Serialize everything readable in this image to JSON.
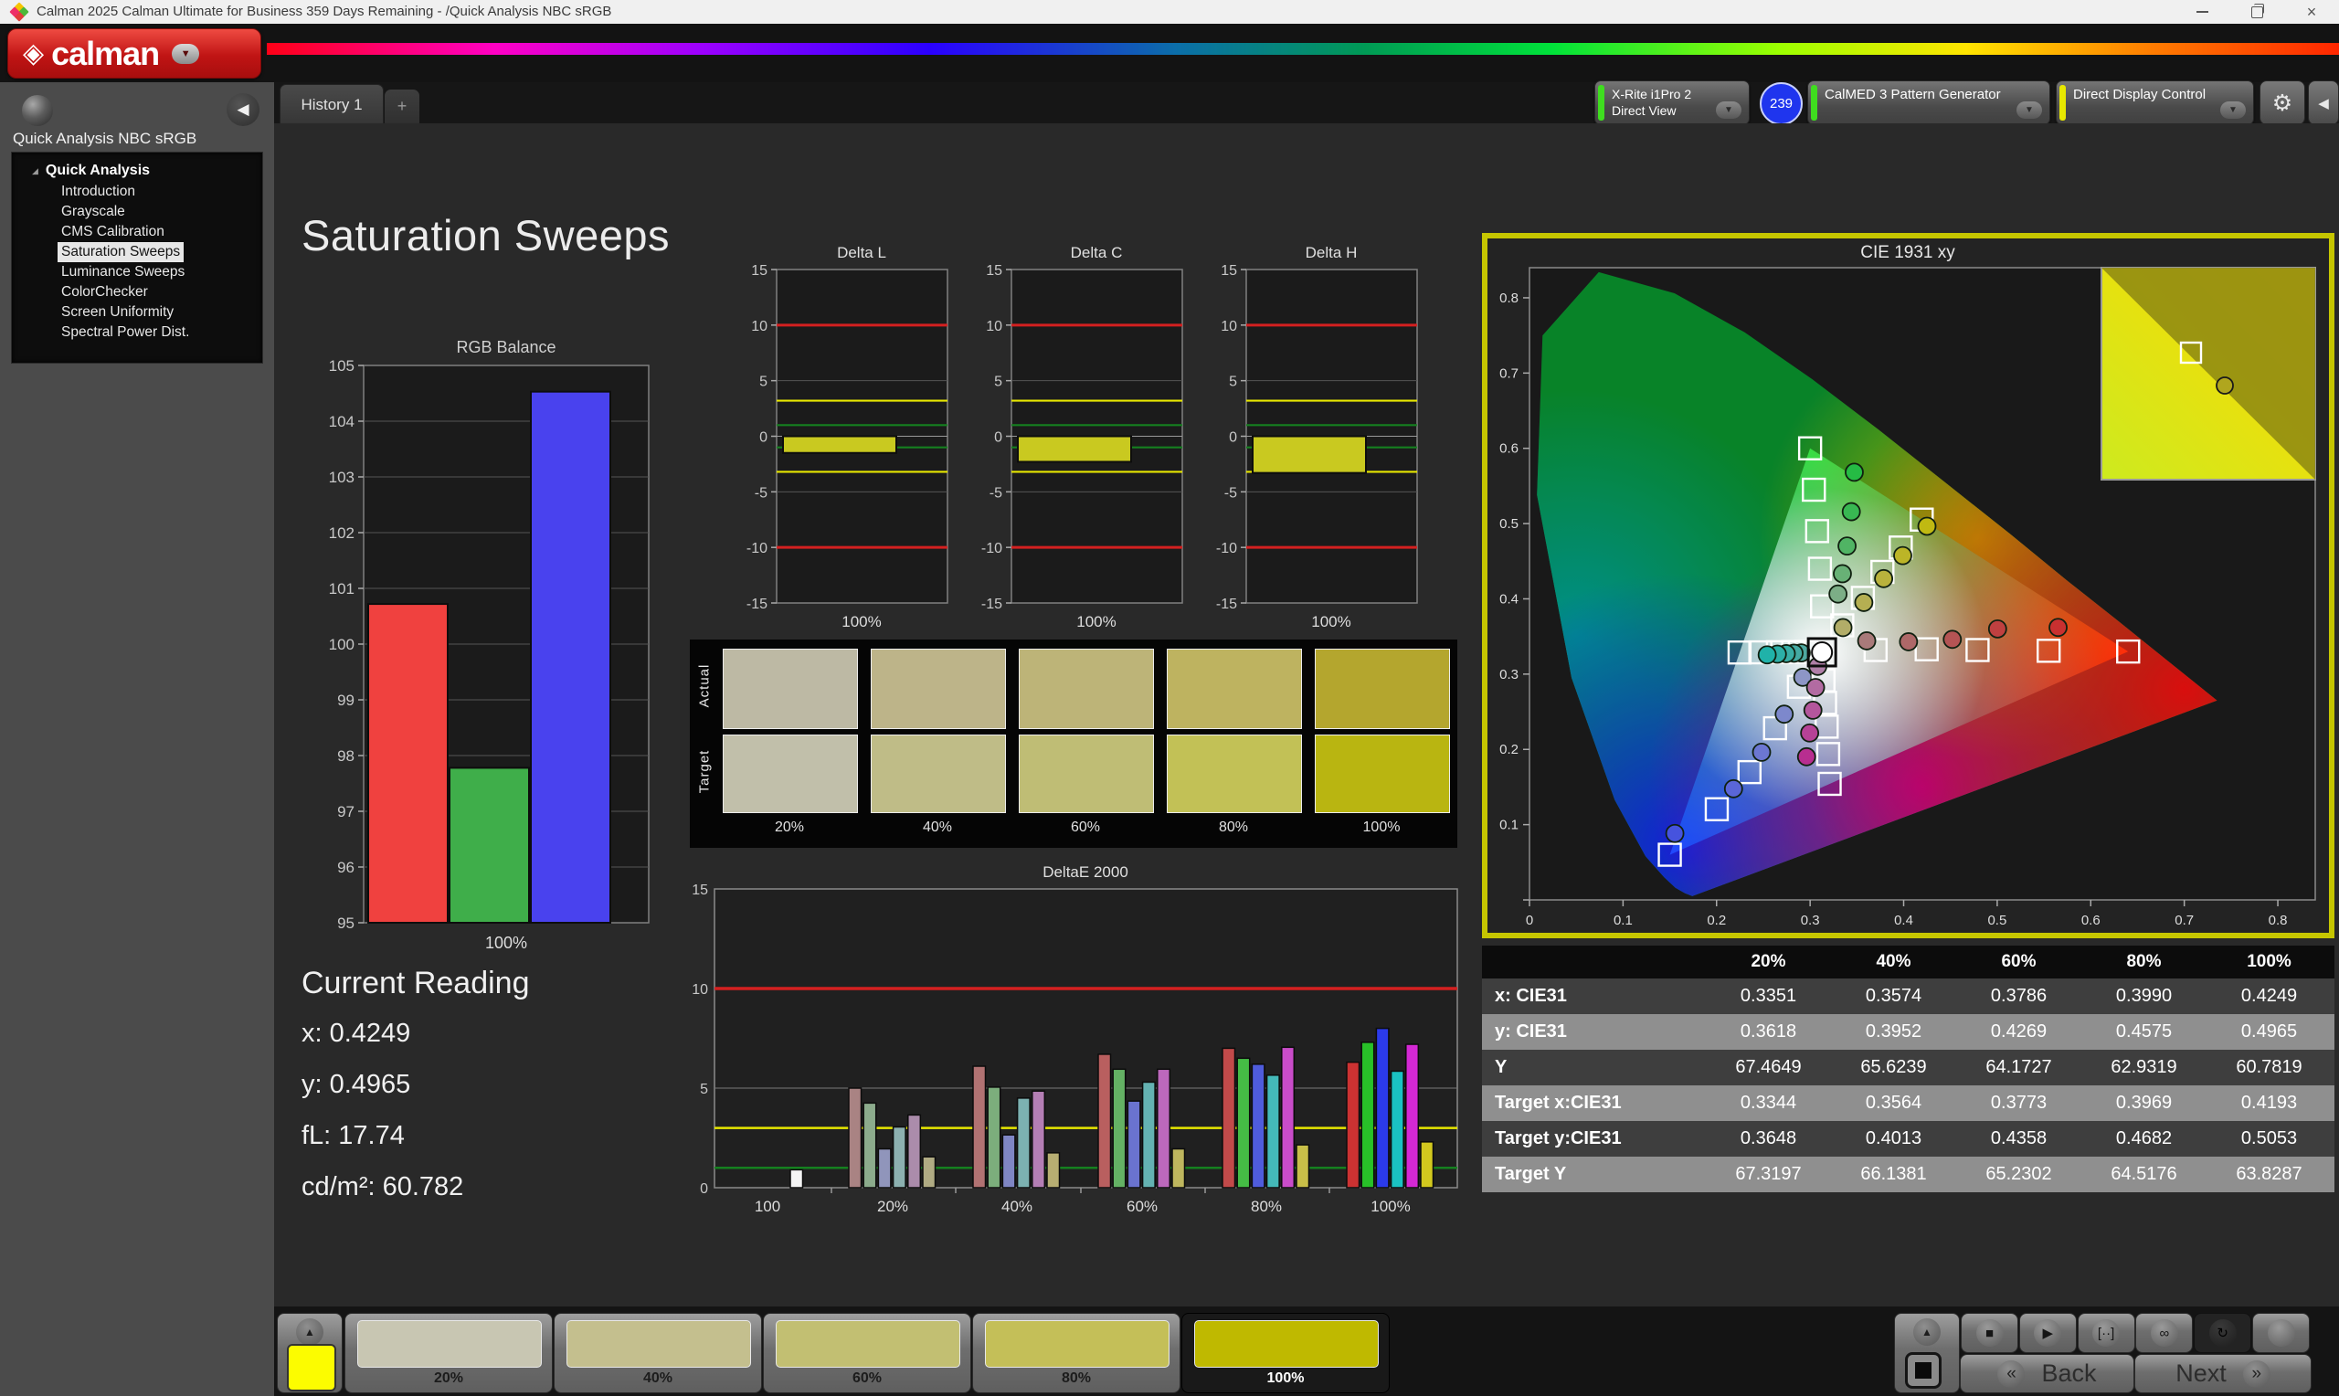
{
  "window": {
    "title": "Calman 2025 Calman Ultimate for Business 359 Days Remaining  - /Quick Analysis NBC sRGB"
  },
  "header": {
    "logo_text": "calman"
  },
  "tabs": {
    "active": "History 1",
    "add": "+"
  },
  "toolbar": {
    "meter_line1": "X-Rite i1Pro 2",
    "meter_line2": "Direct View",
    "meter_badge": "239",
    "meter_accent": "#3fdd1f",
    "pattern_label": "CalMED 3 Pattern Generator",
    "pattern_accent": "#3fdd1f",
    "display_label": "Direct Display Control",
    "display_accent": "#e8e800"
  },
  "sidebar": {
    "workflow_title": "Quick Analysis NBC sRGB",
    "root": "Quick Analysis",
    "items": [
      {
        "label": "Introduction",
        "selected": false
      },
      {
        "label": "Grayscale",
        "selected": false
      },
      {
        "label": "CMS Calibration",
        "selected": false
      },
      {
        "label": "Saturation Sweeps",
        "selected": true
      },
      {
        "label": "Luminance Sweeps",
        "selected": false
      },
      {
        "label": "ColorChecker",
        "selected": false
      },
      {
        "label": "Screen Uniformity",
        "selected": false
      },
      {
        "label": "Spectral Power Dist.",
        "selected": false
      }
    ]
  },
  "page": {
    "title": "Saturation Sweeps"
  },
  "current_reading": {
    "heading": "Current Reading",
    "lines": [
      "x: 0.4249",
      "y: 0.4965",
      "fL: 17.74",
      "cd/m²: 60.782"
    ]
  },
  "swatch_comparison": {
    "row_labels": [
      "Actual",
      "Target"
    ],
    "columns": [
      "20%",
      "40%",
      "60%",
      "80%",
      "100%"
    ],
    "actual": [
      "#bdb9a4",
      "#bdb489",
      "#bdb478",
      "#beb360",
      "#b4a62e"
    ],
    "target": [
      "#c1bfaa",
      "#bfbc87",
      "#bfbd75",
      "#c2c156",
      "#b9b511"
    ]
  },
  "data_table": {
    "columns": [
      "20%",
      "40%",
      "60%",
      "80%",
      "100%"
    ],
    "rows": [
      {
        "label": "x: CIE31",
        "values": [
          "0.3351",
          "0.3574",
          "0.3786",
          "0.3990",
          "0.4249"
        ]
      },
      {
        "label": "y: CIE31",
        "values": [
          "0.3618",
          "0.3952",
          "0.4269",
          "0.4575",
          "0.4965"
        ]
      },
      {
        "label": "Y",
        "values": [
          "67.4649",
          "65.6239",
          "64.1727",
          "62.9319",
          "60.7819"
        ]
      },
      {
        "label": "Target x:CIE31",
        "values": [
          "0.3344",
          "0.3564",
          "0.3773",
          "0.3969",
          "0.4193"
        ]
      },
      {
        "label": "Target y:CIE31",
        "values": [
          "0.3648",
          "0.4013",
          "0.4358",
          "0.4682",
          "0.5053"
        ]
      },
      {
        "label": "Target Y",
        "values": [
          "67.3197",
          "66.1381",
          "65.2302",
          "64.5176",
          "63.8287"
        ]
      }
    ]
  },
  "pattern_bar": {
    "preview": "#fcfc00",
    "swatches": [
      {
        "label": "20%",
        "color": "#c8c6b2",
        "selected": false
      },
      {
        "label": "40%",
        "color": "#c4bf8e",
        "selected": false
      },
      {
        "label": "60%",
        "color": "#c2bf72",
        "selected": false
      },
      {
        "label": "80%",
        "color": "#c4bf58",
        "selected": false
      },
      {
        "label": "100%",
        "color": "#bfb900",
        "selected": true
      }
    ]
  },
  "transport": {
    "back": "Back",
    "next": "Next",
    "buttons": [
      "stop",
      "play",
      "step",
      "infinite",
      "refresh",
      "blank"
    ]
  },
  "icons": {
    "gear": "⚙",
    "collapse": "◀",
    "dropdown": "▼",
    "up": "▲",
    "stop": "■",
    "play": "▶",
    "step": "[··]",
    "infinite": "∞",
    "refresh": "↻",
    "back": "«",
    "next": "»",
    "plus": "+",
    "expander": "◢",
    "logo_mark": "◈"
  },
  "chart_data": [
    {
      "id": "rgb_balance",
      "type": "bar",
      "title": "RGB Balance",
      "categories": [
        "Red",
        "Green",
        "Blue"
      ],
      "values": [
        100.72,
        97.78,
        104.53
      ],
      "colors": [
        "#f0413f",
        "#3fae4a",
        "#4942ee"
      ],
      "xlabel": "100%",
      "ylim": [
        95,
        105
      ],
      "ytick_step": 1
    },
    {
      "id": "delta_l",
      "type": "bar",
      "title": "Delta L",
      "xlabel": "100%",
      "value": -1.5,
      "bar_color": "#c9c920",
      "ylim": [
        -15,
        15
      ],
      "ref_lines": {
        "red": 10,
        "yellow": 3.2,
        "green": 1
      }
    },
    {
      "id": "delta_c",
      "type": "bar",
      "title": "Delta C",
      "xlabel": "100%",
      "value": -2.3,
      "bar_color": "#c9c920",
      "ylim": [
        -15,
        15
      ],
      "ref_lines": {
        "red": 10,
        "yellow": 3.2,
        "green": 1
      }
    },
    {
      "id": "delta_h",
      "type": "bar",
      "title": "Delta H",
      "xlabel": "100%",
      "value": -3.3,
      "bar_color": "#c9c920",
      "ylim": [
        -15,
        15
      ],
      "ref_lines": {
        "red": 10,
        "yellow": 3.2,
        "green": 1
      }
    },
    {
      "id": "deltae_2000",
      "type": "grouped-bar",
      "title": "DeltaE 2000",
      "ylim": [
        0,
        15
      ],
      "yticks": [
        0,
        5,
        10,
        15
      ],
      "ref_lines": {
        "red": 10,
        "yellow": 3,
        "green": 1
      },
      "groups": [
        {
          "label": "100",
          "values": [
            0.9
          ],
          "colors": [
            "#f5f5f5"
          ]
        },
        {
          "label": "20%",
          "values": [
            5.0,
            4.25,
            1.95,
            3.05,
            3.65,
            1.55
          ],
          "colors": [
            "#a98383",
            "#8cab8c",
            "#9095bb",
            "#8cb0b0",
            "#ab8cab",
            "#b0ab83"
          ]
        },
        {
          "label": "40%",
          "values": [
            6.1,
            5.05,
            2.65,
            4.5,
            4.85,
            1.75
          ],
          "colors": [
            "#b17272",
            "#7cae7c",
            "#7f86c4",
            "#7cb1b1",
            "#b47eb4",
            "#b7ae72"
          ]
        },
        {
          "label": "60%",
          "values": [
            6.7,
            5.95,
            4.35,
            5.3,
            5.95,
            1.95
          ],
          "colors": [
            "#b95f5f",
            "#64b164",
            "#6a73cf",
            "#64b2b2",
            "#bc68bc",
            "#beb65e"
          ]
        },
        {
          "label": "80%",
          "values": [
            7.0,
            6.5,
            6.2,
            5.65,
            7.05,
            2.15
          ],
          "colors": [
            "#c24a4a",
            "#45bc45",
            "#4f5cdc",
            "#44b9b9",
            "#c94cc9",
            "#c8bf48"
          ]
        },
        {
          "label": "100%",
          "values": [
            6.3,
            7.3,
            8.0,
            5.85,
            7.2,
            2.3
          ],
          "colors": [
            "#cc3232",
            "#28c028",
            "#2b3aea",
            "#1ac2c2",
            "#d428d4",
            "#d2c81e"
          ]
        }
      ]
    },
    {
      "id": "cie",
      "type": "scatter",
      "title": "CIE 1931 xy",
      "xlim": [
        0,
        0.84
      ],
      "ylim": [
        0,
        0.84
      ],
      "ticks": [
        0,
        0.1,
        0.2,
        0.3,
        0.4,
        0.5,
        0.6,
        0.7,
        0.8
      ],
      "gamut_triangle": [
        [
          0.64,
          0.33
        ],
        [
          0.3,
          0.6
        ],
        [
          0.15,
          0.06
        ]
      ],
      "white_point": {
        "target": [
          0.3127,
          0.329
        ],
        "measured": [
          0.3127,
          0.329
        ]
      },
      "sweeps": [
        {
          "name": "red",
          "targets": [
            [
              0.37,
              0.332
            ],
            [
              0.4246,
              0.333
            ],
            [
              0.479,
              0.332
            ],
            [
              0.555,
              0.331
            ],
            [
              0.64,
              0.33
            ]
          ],
          "measured": [
            [
              0.3605,
              0.3442
            ],
            [
              0.4052,
              0.343
            ],
            [
              0.452,
              0.3462
            ],
            [
              0.5004,
              0.3601
            ],
            [
              0.5651,
              0.362
            ]
          ],
          "mcolors": [
            "#a97a7a",
            "#ae6868",
            "#b45454",
            "#bf4040",
            "#c93030"
          ]
        },
        {
          "name": "green",
          "targets": [
            [
              0.3128,
              0.39
            ],
            [
              0.3105,
              0.44
            ],
            [
              0.3075,
              0.49
            ],
            [
              0.304,
              0.545
            ],
            [
              0.3,
              0.6
            ]
          ],
          "measured": [
            [
              0.3298,
              0.4064
            ],
            [
              0.3345,
              0.4334
            ],
            [
              0.3395,
              0.4702
            ],
            [
              0.344,
              0.5158
            ],
            [
              0.3472,
              0.5682
            ]
          ],
          "mcolors": [
            "#7cae86",
            "#68b176",
            "#50b464",
            "#38b852",
            "#25bb44"
          ]
        },
        {
          "name": "blue",
          "targets": [
            [
              0.288,
              0.2832
            ],
            [
              0.2625,
              0.2281
            ],
            [
              0.2352,
              0.1698
            ],
            [
              0.2002,
              0.1205
            ],
            [
              0.15,
              0.06
            ]
          ],
          "measured": [
            [
              0.2921,
              0.2958
            ],
            [
              0.2723,
              0.2468
            ],
            [
              0.2481,
              0.1962
            ],
            [
              0.2181,
              0.1477
            ],
            [
              0.1554,
              0.0883
            ]
          ],
          "mcolors": [
            "#8d96c6",
            "#7d88cc",
            "#6c77d2",
            "#5a66d8",
            "#4653de"
          ]
        },
        {
          "name": "cyan",
          "targets": [
            [
              0.2958,
              0.3295
            ],
            [
              0.282,
              0.3293
            ],
            [
              0.2656,
              0.3291
            ],
            [
              0.2468,
              0.3289
            ],
            [
              0.2246,
              0.3287
            ]
          ],
          "measured": [
            [
              0.2905,
              0.3282
            ],
            [
              0.2828,
              0.3278
            ],
            [
              0.2745,
              0.3272
            ],
            [
              0.265,
              0.3265
            ],
            [
              0.2541,
              0.3256
            ]
          ],
          "mcolors": [
            "#4fa8a1",
            "#44aaa3",
            "#38ada5",
            "#2cafa7",
            "#20b2a9"
          ]
        },
        {
          "name": "magenta",
          "targets": [
            [
              0.3143,
              0.2918
            ],
            [
              0.316,
              0.2618
            ],
            [
              0.3177,
              0.2302
            ],
            [
              0.3193,
              0.1938
            ],
            [
              0.3209,
              0.1542
            ]
          ],
          "measured": [
            [
              0.3082,
              0.3104
            ],
            [
              0.3058,
              0.2822
            ],
            [
              0.303,
              0.252
            ],
            [
              0.2995,
              0.2218
            ],
            [
              0.2962,
              0.1902
            ]
          ],
          "mcolors": [
            "#b07fa8",
            "#b26ba2",
            "#b4569c",
            "#b64296",
            "#b82e90"
          ]
        },
        {
          "name": "yellow",
          "targets": [
            [
              0.3344,
              0.3648
            ],
            [
              0.3564,
              0.4013
            ],
            [
              0.3773,
              0.4358
            ],
            [
              0.3969,
              0.4682
            ],
            [
              0.4193,
              0.5053
            ]
          ],
          "measured": [
            [
              0.3351,
              0.3618
            ],
            [
              0.3574,
              0.3952
            ],
            [
              0.3786,
              0.4269
            ],
            [
              0.399,
              0.4575
            ],
            [
              0.4249,
              0.4965
            ]
          ],
          "mcolors": [
            "#b2ad68",
            "#b5af52",
            "#b9b23c",
            "#bcb527",
            "#c0b912"
          ]
        }
      ]
    }
  ]
}
